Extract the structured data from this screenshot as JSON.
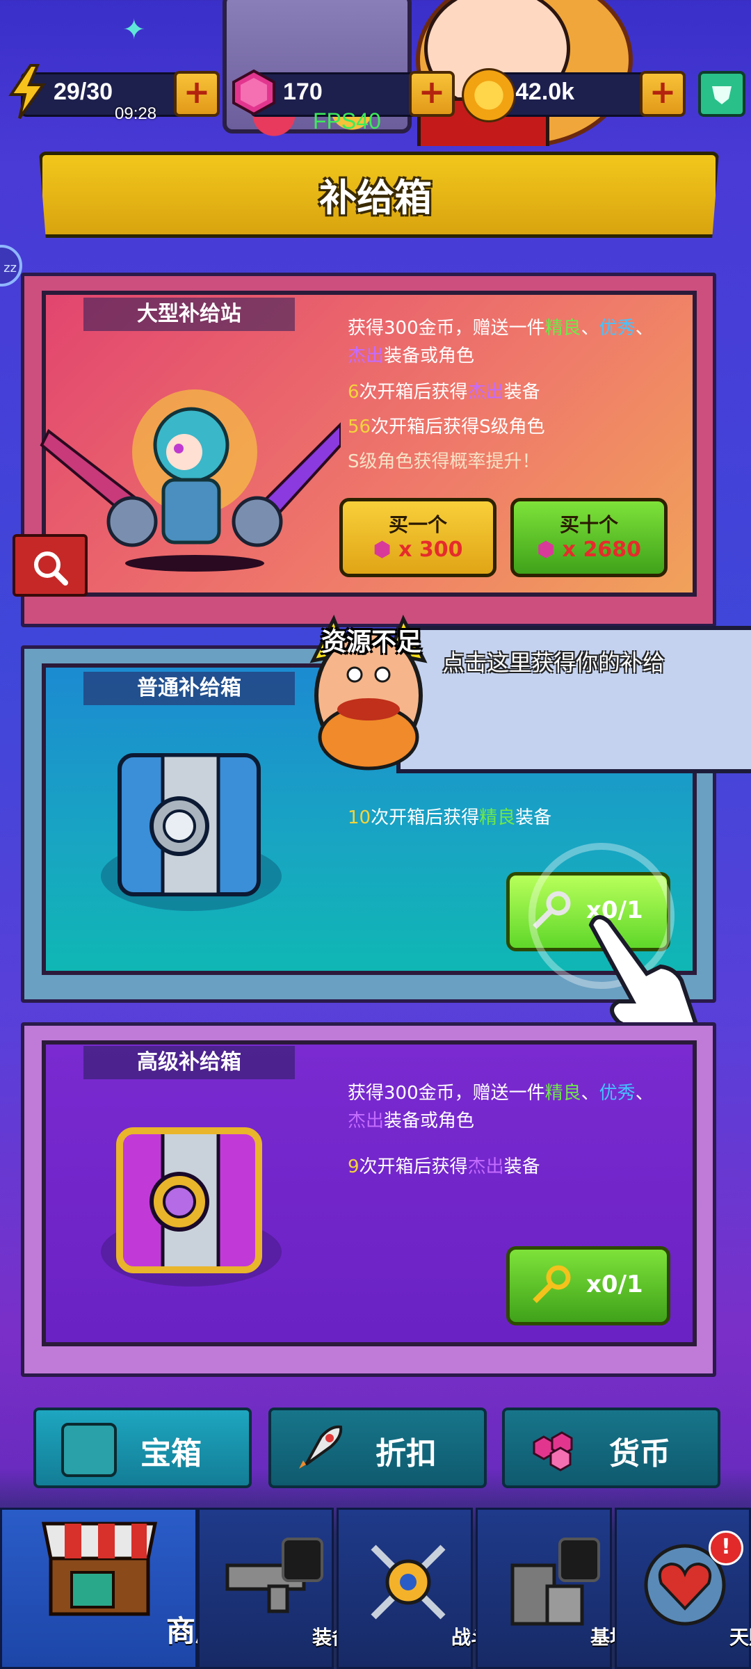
{
  "resources": {
    "energy": "29/30",
    "gems": "170",
    "coins": "42.0k",
    "timer": "09:28",
    "fps": "FPS40"
  },
  "header": {
    "title": "补给箱"
  },
  "large_station": {
    "label": "大型补给站",
    "desc_line1_a": "获得300金币，赠送一件",
    "desc_elite": "精良",
    "desc_sep": "、",
    "desc_excellent": "优秀",
    "desc_sep2": "、",
    "desc_line2_outstanding": "杰出",
    "desc_line2_rest": "装备或角色",
    "line3_num": "6",
    "line3_a": "次开箱后获得",
    "line3_outstanding": "杰出",
    "line3_b": "装备",
    "line4_num": "56",
    "line4_text": "次开箱后获得S级角色",
    "line5": "S级角色获得概率提升！",
    "buy_one_label": "买一个",
    "buy_one_price": "x 300",
    "buy_ten_label": "买十个",
    "buy_ten_price": "x 2680"
  },
  "normal_box": {
    "label": "普通补给箱",
    "line_num": "10",
    "line_a": "次开箱后获得",
    "line_elite": "精良",
    "line_b": "装备",
    "key_count": "x0/1"
  },
  "advanced_box": {
    "label": "高级补给箱",
    "desc_line1_a": "获得300金币，赠送一件",
    "desc_elite": "精良",
    "desc_sep": "、",
    "desc_excellent": "优秀",
    "desc_sep2": "、",
    "desc_line2_outstanding": "杰出",
    "desc_line2_rest": "装备或角色",
    "line_num": "9",
    "line_a": "次开箱后获得",
    "line_outstanding": "杰出",
    "line_b": "装备",
    "key_count": "x0/1"
  },
  "tutorial": {
    "not_enough": "资源不足",
    "hint": "点击这里获得你的补给"
  },
  "tabs": [
    {
      "label": "宝箱",
      "icon": "chest-icon"
    },
    {
      "label": "折扣",
      "icon": "rocket-icon"
    },
    {
      "label": "货币",
      "icon": "gems-icon"
    }
  ],
  "nav": [
    {
      "label": "商店",
      "icon": "shop-icon"
    },
    {
      "label": "装备",
      "icon": "gun-icon"
    },
    {
      "label": "战斗",
      "icon": "battle-icon"
    },
    {
      "label": "基地",
      "icon": "base-icon"
    },
    {
      "label": "天赋",
      "icon": "talent-icon"
    }
  ],
  "colors": {
    "accent_yellow": "#f3d43b",
    "elite_green": "#6fe84a",
    "excellent_blue": "#45c3ff",
    "outstanding_purple": "#c46cff"
  }
}
